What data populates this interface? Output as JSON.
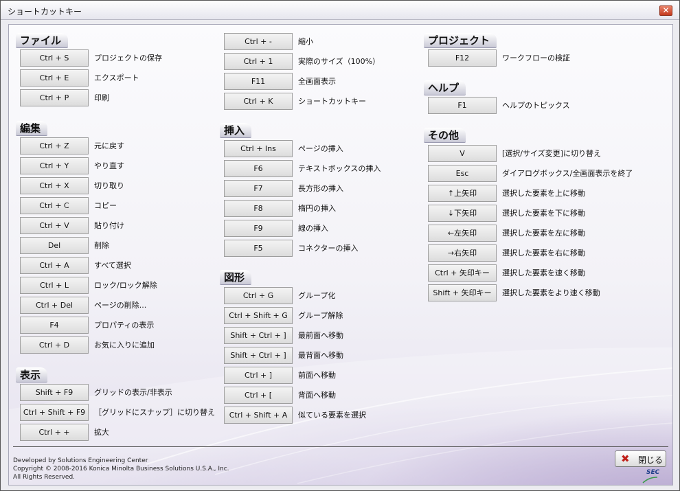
{
  "window": {
    "title": "ショートカットキー",
    "close_glyph": "✕"
  },
  "sections": {
    "file": {
      "title": "ファイル",
      "items": [
        {
          "key": "Ctrl + S",
          "desc": "プロジェクトの保存"
        },
        {
          "key": "Ctrl + E",
          "desc": "エクスポート"
        },
        {
          "key": "Ctrl + P",
          "desc": "印刷"
        }
      ]
    },
    "edit": {
      "title": "編集",
      "items": [
        {
          "key": "Ctrl + Z",
          "desc": "元に戻す"
        },
        {
          "key": "Ctrl + Y",
          "desc": "やり直す"
        },
        {
          "key": "Ctrl + X",
          "desc": "切り取り"
        },
        {
          "key": "Ctrl + C",
          "desc": "コピー"
        },
        {
          "key": "Ctrl + V",
          "desc": "貼り付け"
        },
        {
          "key": "Del",
          "desc": "削除"
        },
        {
          "key": "Ctrl + A",
          "desc": "すべて選択"
        },
        {
          "key": "Ctrl + L",
          "desc": "ロック/ロック解除"
        },
        {
          "key": "Ctrl + Del",
          "desc": "ページの削除..."
        },
        {
          "key": "F4",
          "desc": "プロパティの表示"
        },
        {
          "key": "Ctrl + D",
          "desc": "お気に入りに追加"
        }
      ]
    },
    "view": {
      "title": "表示",
      "items": [
        {
          "key": "Shift + F9",
          "desc": "グリッドの表示/非表示"
        },
        {
          "key": "Ctrl + Shift + F9",
          "desc": "［グリッドにスナップ］に切り替え"
        },
        {
          "key": "Ctrl + +",
          "desc": "拡大"
        }
      ]
    },
    "view_cont": {
      "items": [
        {
          "key": "Ctrl + -",
          "desc": "縮小"
        },
        {
          "key": "Ctrl + 1",
          "desc": "実際のサイズ（100%）"
        },
        {
          "key": "F11",
          "desc": "全画面表示"
        },
        {
          "key": "Ctrl + K",
          "desc": "ショートカットキー"
        }
      ]
    },
    "insert": {
      "title": "挿入",
      "items": [
        {
          "key": "Ctrl + Ins",
          "desc": "ページの挿入"
        },
        {
          "key": "F6",
          "desc": "テキストボックスの挿入"
        },
        {
          "key": "F7",
          "desc": "長方形の挿入"
        },
        {
          "key": "F8",
          "desc": "楕円の挿入"
        },
        {
          "key": "F9",
          "desc": "線の挿入"
        },
        {
          "key": "F5",
          "desc": "コネクターの挿入"
        }
      ]
    },
    "shape": {
      "title": "図形",
      "items": [
        {
          "key": "Ctrl + G",
          "desc": "グループ化"
        },
        {
          "key": "Ctrl + Shift + G",
          "desc": "グループ解除"
        },
        {
          "key": "Shift + Ctrl + ]",
          "desc": "最前面へ移動"
        },
        {
          "key": "Shift + Ctrl + ]",
          "desc": "最背面へ移動"
        },
        {
          "key": "Ctrl + ]",
          "desc": "前面へ移動"
        },
        {
          "key": "Ctrl + [",
          "desc": "背面へ移動"
        },
        {
          "key": "Ctrl + Shift + A",
          "desc": "似ている要素を選択"
        }
      ]
    },
    "project": {
      "title": "プロジェクト",
      "items": [
        {
          "key": "F12",
          "desc": "ワークフローの検証"
        }
      ]
    },
    "help": {
      "title": "ヘルプ",
      "items": [
        {
          "key": "F1",
          "desc": "ヘルプのトピックス"
        }
      ]
    },
    "other": {
      "title": "その他",
      "items": [
        {
          "key": "V",
          "desc": "[選択/サイズ変更]に切り替え"
        },
        {
          "key": "Esc",
          "desc": "ダイアログボックス/全画面表示を終了"
        },
        {
          "key": "↑上矢印",
          "desc": "選択した要素を上に移動"
        },
        {
          "key": "↓下矢印",
          "desc": "選択した要素を下に移動"
        },
        {
          "key": "←左矢印",
          "desc": "選択した要素を左に移動"
        },
        {
          "key": "→右矢印",
          "desc": "選択した要素を右に移動"
        },
        {
          "key": "Ctrl + 矢印キー",
          "desc": "選択した要素を速く移動"
        },
        {
          "key": "Shift + 矢印キー",
          "desc": "選択した要素をより速く移動"
        }
      ]
    }
  },
  "footer": {
    "line1": "Developed by Solutions Engineering Center",
    "line2": "Copyright © 2008-2016 Konica Minolta Business Solutions U.S.A., Inc.",
    "line3": "All Rights Reserved.",
    "close_label": "閉じる",
    "close_icon": "close-x-icon",
    "logo_text": "SEC"
  }
}
